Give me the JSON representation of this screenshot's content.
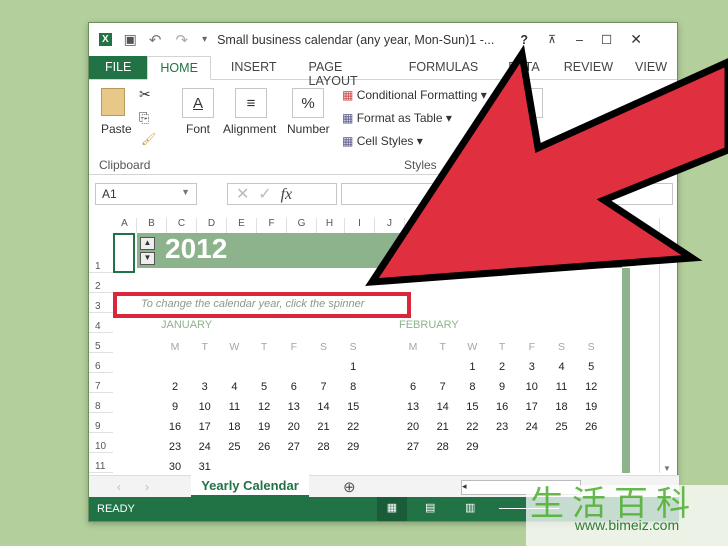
{
  "window": {
    "title": "Small business calendar (any year, Mon-Sun)1 -...",
    "help": "?"
  },
  "tabs": [
    "FILE",
    "HOME",
    "INSERT",
    "PAGE LAYOUT",
    "FORMULAS",
    "DATA",
    "REVIEW",
    "VIEW"
  ],
  "ribbon": {
    "paste": "Paste",
    "clipboard": "Clipboard",
    "font": "Font",
    "alignment": "Alignment",
    "number": "Number",
    "conditional": "Conditional Formatting",
    "format_table": "Format as Table",
    "cell_styles": "Cell Styles",
    "styles": "Styles",
    "cells": "C"
  },
  "formula_bar": {
    "name_box": "A1",
    "fx": "fx",
    "value": ""
  },
  "columns": [
    "A",
    "B",
    "C",
    "D",
    "E",
    "F",
    "G",
    "H",
    "I",
    "J",
    "K",
    "L"
  ],
  "rows": [
    "1",
    "2",
    "3",
    "4",
    "5",
    "6",
    "7",
    "8",
    "9",
    "10",
    "11"
  ],
  "sheet": {
    "year": "2012",
    "hint": "To change the calendar year, click the spinner",
    "months": [
      {
        "name": "JANUARY",
        "dow": [
          "M",
          "T",
          "W",
          "T",
          "F",
          "S",
          "S"
        ],
        "weeks": [
          [
            "",
            "",
            "",
            "",
            "",
            "",
            "1"
          ],
          [
            "2",
            "3",
            "4",
            "5",
            "6",
            "7",
            "8"
          ],
          [
            "9",
            "10",
            "11",
            "12",
            "13",
            "14",
            "15"
          ],
          [
            "16",
            "17",
            "18",
            "19",
            "20",
            "21",
            "22"
          ],
          [
            "23",
            "24",
            "25",
            "26",
            "27",
            "28",
            "29"
          ],
          [
            "30",
            "31",
            "",
            "",
            "",
            "",
            ""
          ]
        ]
      },
      {
        "name": "FEBRUARY",
        "dow": [
          "M",
          "T",
          "W",
          "T",
          "F",
          "S",
          "S"
        ],
        "weeks": [
          [
            "",
            "",
            "1",
            "2",
            "3",
            "4",
            "5"
          ],
          [
            "6",
            "7",
            "8",
            "9",
            "10",
            "11",
            "12"
          ],
          [
            "13",
            "14",
            "15",
            "16",
            "17",
            "18",
            "19"
          ],
          [
            "20",
            "21",
            "22",
            "23",
            "24",
            "25",
            "26"
          ],
          [
            "27",
            "28",
            "29",
            "",
            "",
            "",
            ""
          ],
          [
            "",
            "",
            "",
            "",
            "",
            "",
            ""
          ]
        ]
      }
    ]
  },
  "sheet_tabs": [
    "Yearly Calendar"
  ],
  "status": "READY",
  "watermark": {
    "chars": "生活百科",
    "url": "www.bimeiz.com"
  },
  "colors": {
    "excel_green": "#217346",
    "header_green": "#8db38c",
    "arrow_red": "#e03040"
  }
}
